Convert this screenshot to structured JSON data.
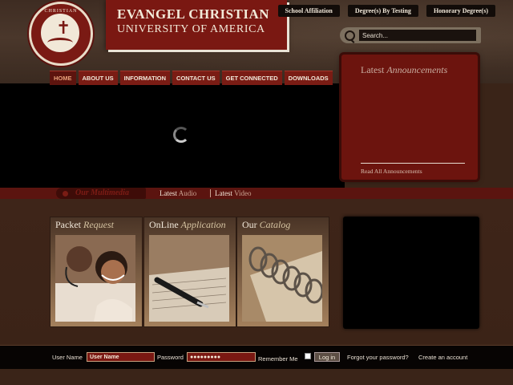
{
  "header": {
    "seal_text": "CHRISTIAN",
    "title_line1": "EVANGEL CHRISTIAN",
    "title_line2": "UNIVERSITY OF AMERICA"
  },
  "top_links": [
    "School Affiliation",
    "Degree(s) By Testing",
    "Honorary Degree(s)"
  ],
  "search": {
    "placeholder": "Search..."
  },
  "nav": {
    "items": [
      {
        "label": "HOME",
        "active": true
      },
      {
        "label": "ABOUT US"
      },
      {
        "label": "INFORMATION"
      },
      {
        "label": "CONTACT US"
      },
      {
        "label": "GET CONNECTED"
      },
      {
        "label": "DOWNLOADS"
      }
    ]
  },
  "announcements": {
    "title_plain": "Latest",
    "title_em": "Announcements",
    "read_all": "Read All Announcements"
  },
  "multimedia": {
    "label": "Our Multimedia",
    "tabs": [
      {
        "lead": "Latest",
        "accent": "Audio"
      },
      {
        "lead": "Latest",
        "accent": "Video"
      }
    ]
  },
  "cards": [
    {
      "plain": "Packet",
      "em": "Request"
    },
    {
      "plain": "OnLine",
      "em": "Application"
    },
    {
      "plain": "Our",
      "em": "Catalog"
    }
  ],
  "login": {
    "username_label": "User Name",
    "username_value": "User Name",
    "password_label": "Password",
    "password_value": "●●●●●●●●●",
    "remember_label": "Remember Me",
    "login_button": "Log in",
    "forgot_link": "Forgot your password?",
    "create_link": "Create an account"
  },
  "colors": {
    "brand_red": "#7a1812",
    "dark_brown": "#3a2418",
    "cream": "#f2ead9"
  }
}
